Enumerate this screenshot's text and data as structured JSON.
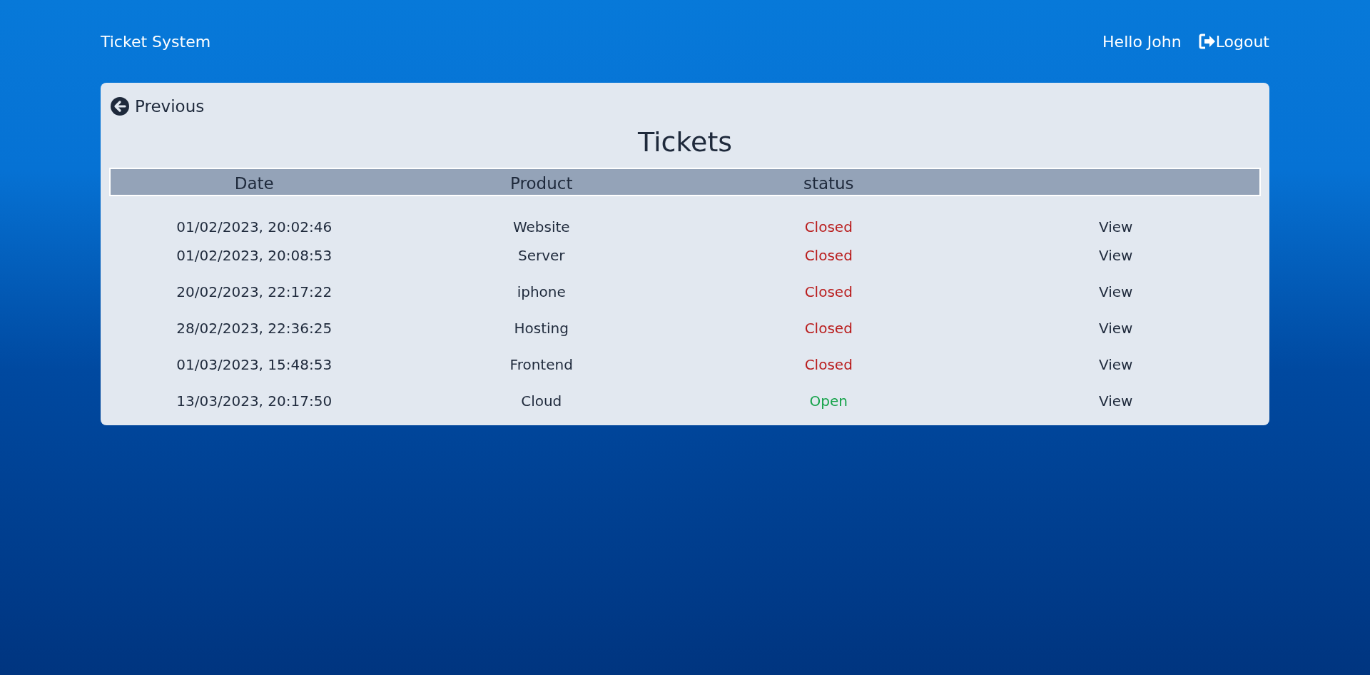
{
  "brand": "Ticket System",
  "user_greeting": "Hello John",
  "logout": "Logout",
  "back_link": "Previous",
  "title": "Tickets",
  "table": {
    "columns": [
      "Date",
      "Product",
      "status"
    ],
    "rows": [
      {
        "date": "01/02/2023, 20:02:46",
        "product": "Website",
        "status": "Closed",
        "kind": "closed",
        "action": "View"
      },
      {
        "date": "01/02/2023, 20:08:53",
        "product": "Server",
        "status": "Closed",
        "kind": "closed",
        "action": "View"
      },
      {
        "date": "20/02/2023, 22:17:22",
        "product": "iphone",
        "status": "Closed",
        "kind": "closed",
        "action": "View"
      },
      {
        "date": "28/02/2023, 22:36:25",
        "product": "Hosting",
        "status": "Closed",
        "kind": "closed",
        "action": "View"
      },
      {
        "date": "01/03/2023, 15:48:53",
        "product": "Frontend",
        "status": "Closed",
        "kind": "closed",
        "action": "View"
      },
      {
        "date": "13/03/2023, 20:17:50",
        "product": "Cloud",
        "status": "Open",
        "kind": "open",
        "action": "View"
      }
    ]
  }
}
